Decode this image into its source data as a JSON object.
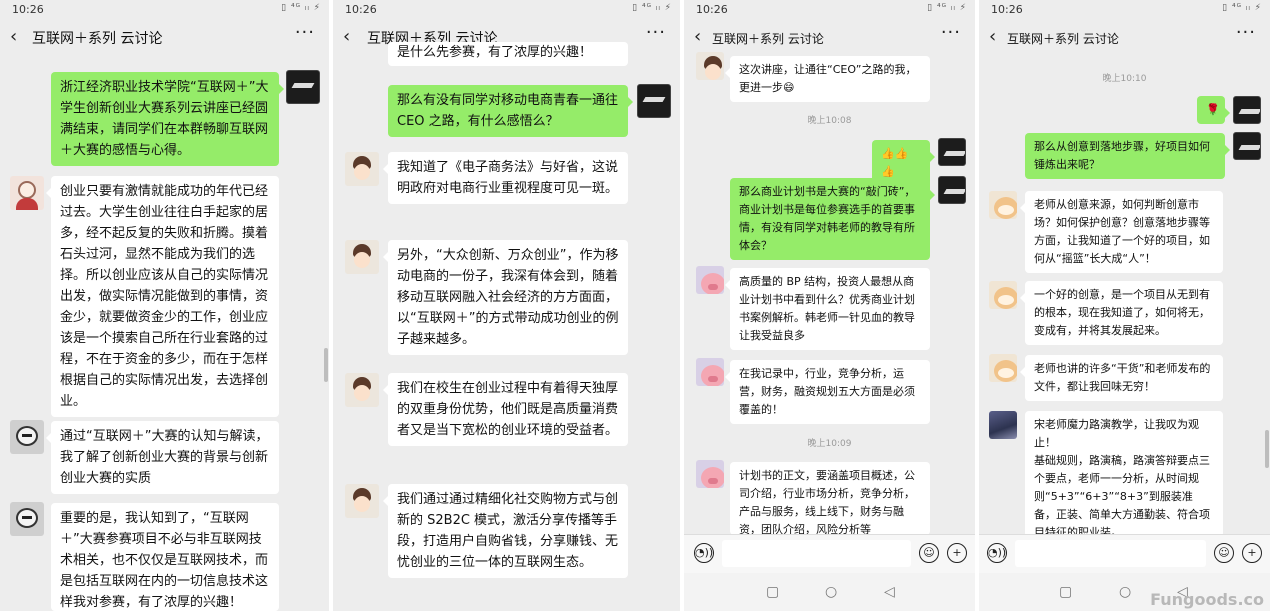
{
  "status": {
    "time": "10:26",
    "icons": "▯ ⁴ᴳ ₗₗ ⚡"
  },
  "header": {
    "back": "‹",
    "title": "互联网＋系列  云讨论",
    "more": "···"
  },
  "icons": {
    "voice": "voice-icon",
    "emoji": "emoji-icon",
    "plus": "plus-icon",
    "square": "recent-apps-icon",
    "circle": "home-icon",
    "triangle": "back-nav-icon"
  },
  "navbar": {
    "square": "▢",
    "circle": "○",
    "triangle": "◁"
  },
  "inputbar": {
    "voice": "◔))",
    "emoji": "☺",
    "plus": "+"
  },
  "panel1": {
    "messages": [
      "浙江经济职业技术学院“互联网＋”大学生创新创业大赛系列云讲座已经圆满结束，请同学们在本群畅聊互联网＋大赛的感悟与心得。",
      "创业只要有激情就能成功的年代已经过去。大学生创业往往白手起家的居多，经不起反复的失败和折腾。摸着石头过河，显然不能成为我们的选择。所以创业应该从自己的实际情况出发，做实际情况能做到的事情，资金少，就要做资金少的工作，创业应该是一个摸索自己所在行业套路的过程，不在于资金的多少，而在于怎样根据自己的实际情况出发，去选择创业。",
      "通过“互联网＋”大赛的认知与解读，我了解了创新创业大赛的背景与创新创业大赛的实质",
      "重要的是，我认知到了，“互联网＋”大赛参赛项目不必与非互联网技术相关，也不仅仅是互联网技术，而是包括互联网在内的一切信息技术这样我对参赛，有了浓厚的兴趣！"
    ]
  },
  "panel2": {
    "top_fragment": "是什么先参赛，有了浓厚的兴趣！",
    "messages": [
      "那么有没有同学对移动电商青春一通往 CEO 之路，有什么感悟么？",
      "我知道了《电子商务法》与好省，这说明政府对电商行业重视程度可见一斑。",
      "另外，“大众创新、万众创业”，作为移动电商的一份子，我深有体会到，随着移动互联网融入社会经济的方方面面，以“互联网＋”的方式带动成功创业的例子越来越多。",
      "我们在校生在创业过程中有着得天独厚的双重身份优势，他们既是高质量消费者又是当下宽松的创业环境的受益者。",
      "我们通过通过精细化社交购物方式与创新的 S2B2C 模式，激活分享传播等手段，打造用户自购省钱，分享赚钱、无忧创业的三位一体的互联网生态。"
    ]
  },
  "panel3": {
    "messages": [
      "这次讲座，让通往“CEO”之路的我，更进一步😄",
      "👍👍👍",
      "那么商业计划书是大赛的“敲门砖”，商业计划书是每位参赛选手的首要事情，有没有同学对韩老师的教导有所体会？",
      "高质量的 BP 结构，投资人最想从商业计划书中看到什么？优秀商业计划书案例解析。韩老师一针见血的教导让我受益良多",
      "在我记录中，行业，竞争分析，运营，财务，融资规划五大方面是必须覆盖的！",
      "计划书的正文，要涵盖项目概述，公司介绍，行业市场分析，竞争分析，产品与服务，线上线下，财务与融资，团队介绍，风险分析等"
    ],
    "timestamps": [
      "晚上10:08",
      "晚上10:09"
    ]
  },
  "panel4": {
    "messages": [
      "🌹",
      "那么从创意到落地步骤，好项目如何锤炼出来呢？",
      "老师从创意来源，如何判断创意市场？如何保护创意？创意落地步骤等方面，让我知道了一个好的项目，如何从“摇篮”长大成“人”！",
      "一个好的创意，是一个项目从无到有的根本，现在我知道了，如何将无，变成有，并将其发展起来。",
      "老师也讲的许多“干货”和老师发布的文件，都让我回味无穷！",
      "宋老师魔力路演教学，让我叹为观止！\n基础规则，路演稿，路演答辩要点三个要点，老师一一分析，从时间规则“5+3”“6+3”“8+3”到服装准备，正装、简单大方通勤装、符合项目特征的职业装。"
    ],
    "timestamps": [
      "晚上10:10"
    ],
    "watermark": "Fungoods.co"
  }
}
